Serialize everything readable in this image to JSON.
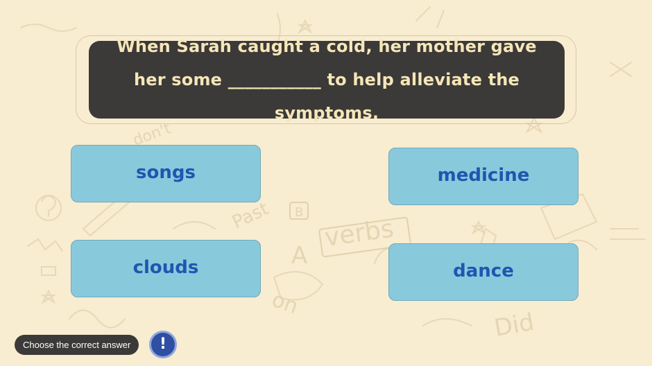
{
  "question": {
    "text": "When Sarah caught a cold, her mother gave her some ___________ to help alleviate the symptoms."
  },
  "answers": [
    {
      "label": "songs"
    },
    {
      "label": "medicine"
    },
    {
      "label": "clouds"
    },
    {
      "label": "dance"
    }
  ],
  "footer": {
    "instruction": "Choose the correct answer",
    "hint_icon": "exclamation-icon",
    "hint_glyph": "!"
  },
  "background": {
    "doodle_words": [
      "don't",
      "Past",
      "verbs",
      "Did",
      "on",
      "A",
      "B"
    ]
  },
  "colors": {
    "background": "#f8ecd1",
    "question_box": "#3b3a38",
    "question_text": "#f6e6b8",
    "answer_fill": "#89c9dc",
    "answer_text": "#1d57b0",
    "hint_button": "#2f4fa3"
  }
}
